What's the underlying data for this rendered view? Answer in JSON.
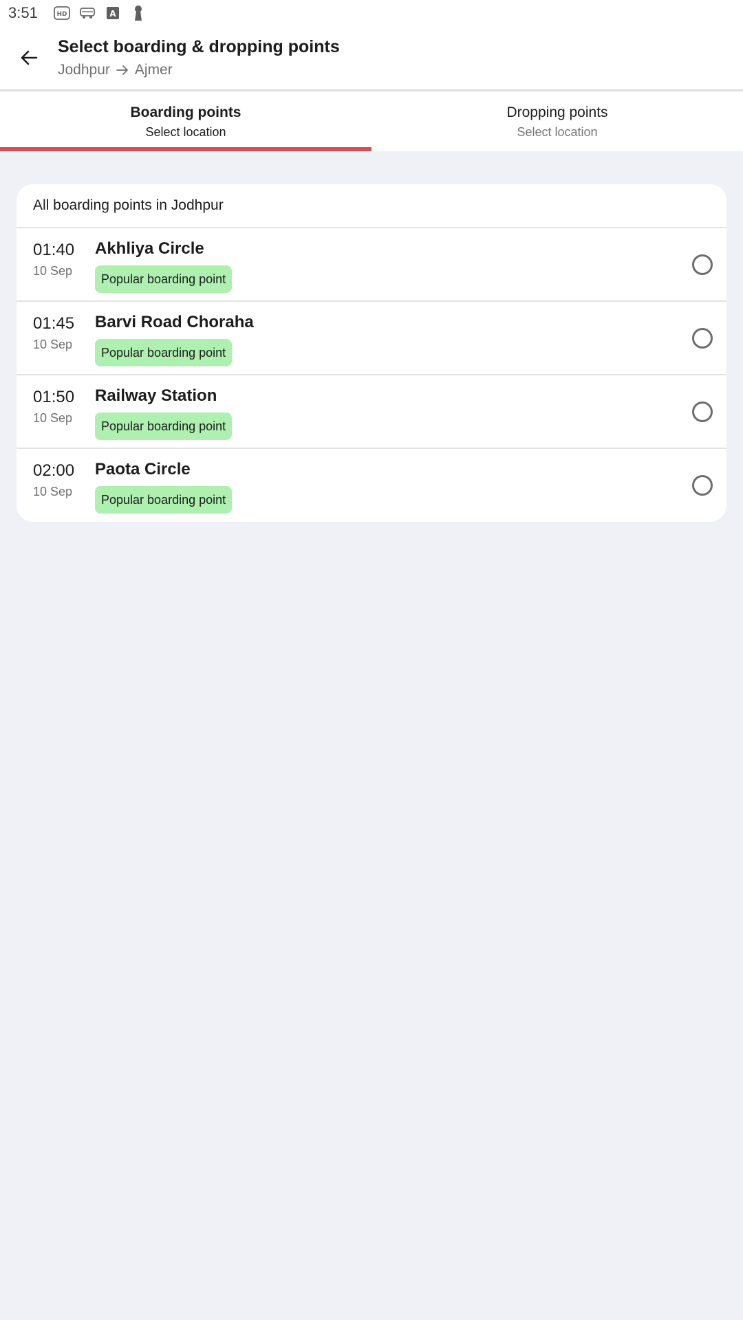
{
  "status_bar": {
    "time": "3:51",
    "icons": [
      "hd-icon",
      "bus-app-icon",
      "a-icon",
      "keyhole-icon"
    ]
  },
  "header": {
    "title": "Select boarding & dropping points",
    "route_from": "Jodhpur",
    "route_to": "Ajmer"
  },
  "tabs": [
    {
      "title": "Boarding points",
      "subtitle": "Select location",
      "active": true
    },
    {
      "title": "Dropping points",
      "subtitle": "Select location",
      "active": false
    }
  ],
  "card": {
    "header": "All boarding points in Jodhpur",
    "points": [
      {
        "time": "01:40",
        "date": "10 Sep",
        "name": "Akhliya Circle",
        "badge": "Popular boarding point",
        "selected": false
      },
      {
        "time": "01:45",
        "date": "10 Sep",
        "name": "Barvi Road Choraha",
        "badge": "Popular boarding point",
        "selected": false
      },
      {
        "time": "01:50",
        "date": "10 Sep",
        "name": "Railway Station",
        "badge": "Popular boarding point",
        "selected": false
      },
      {
        "time": "02:00",
        "date": "10 Sep",
        "name": "Paota Circle",
        "badge": "Popular boarding point",
        "selected": false
      }
    ]
  },
  "colors": {
    "accent": "#d84e55",
    "badge_bg": "#aef0b0",
    "page_bg": "#f0f0f7"
  }
}
